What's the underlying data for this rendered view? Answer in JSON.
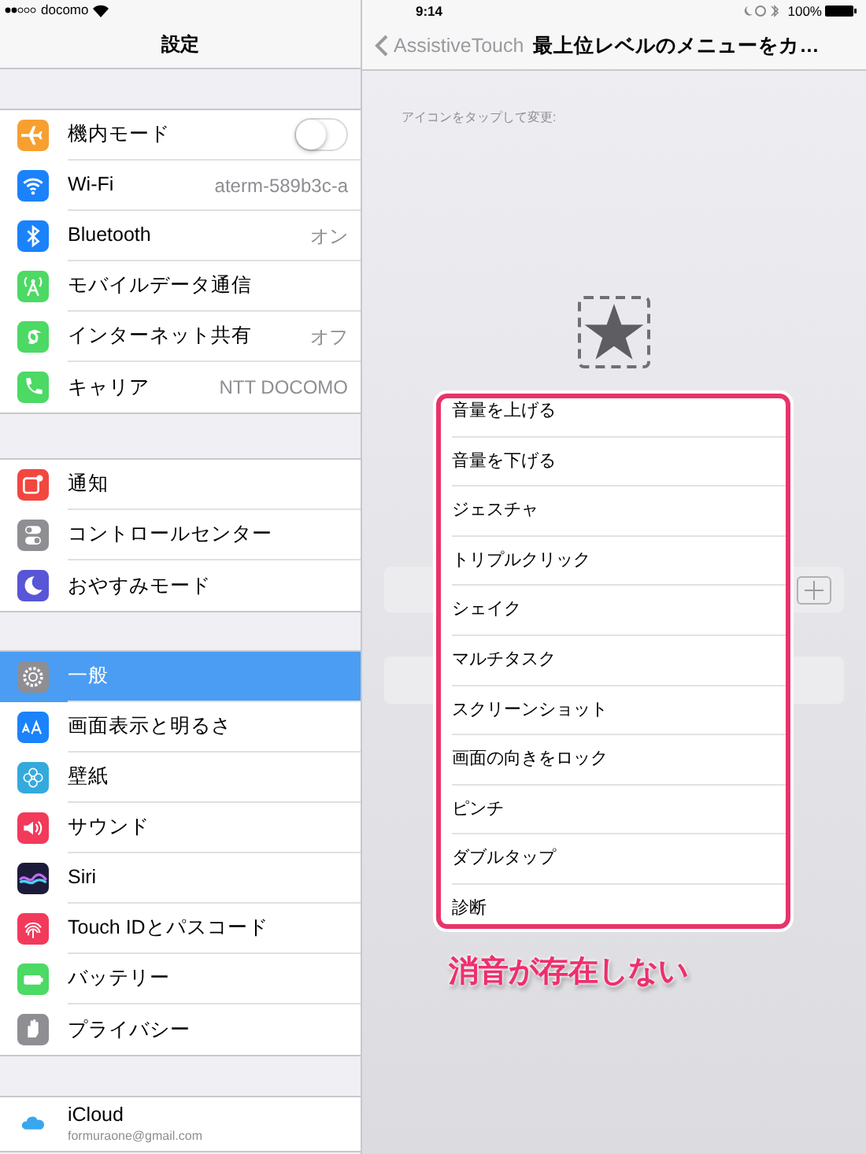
{
  "status_bar": {
    "carrier": "docomo",
    "time": "9:14",
    "battery": "100%"
  },
  "sidebar": {
    "title": "設定",
    "groups": [
      [
        {
          "kind": "toggle",
          "label": "機内モード",
          "on": false,
          "selected": false
        },
        {
          "kind": "value",
          "label": "Wi-Fi",
          "value": "aterm-589b3c-a",
          "selected": false
        },
        {
          "kind": "value",
          "label": "Bluetooth",
          "value": "オン",
          "selected": false
        },
        {
          "kind": "plain",
          "label": "モバイルデータ通信",
          "selected": false
        },
        {
          "kind": "value",
          "label": "インターネット共有",
          "value": "オフ",
          "selected": false
        },
        {
          "kind": "value",
          "label": "キャリア",
          "value": "NTT DOCOMO",
          "selected": false
        }
      ],
      [
        {
          "kind": "plain",
          "label": "通知",
          "selected": false
        },
        {
          "kind": "plain",
          "label": "コントロールセンター",
          "selected": false
        },
        {
          "kind": "plain",
          "label": "おやすみモード",
          "selected": false
        }
      ],
      [
        {
          "kind": "plain",
          "label": "一般",
          "selected": true
        },
        {
          "kind": "plain",
          "label": "画面表示と明るさ",
          "selected": false
        },
        {
          "kind": "plain",
          "label": "壁紙",
          "selected": false
        },
        {
          "kind": "plain",
          "label": "サウンド",
          "selected": false
        },
        {
          "kind": "plain",
          "label": "Siri",
          "selected": false
        },
        {
          "kind": "plain",
          "label": "Touch IDとパスコード",
          "selected": false
        },
        {
          "kind": "plain",
          "label": "バッテリー",
          "selected": false
        },
        {
          "kind": "plain",
          "label": "プライバシー",
          "selected": false
        }
      ],
      [
        {
          "kind": "account",
          "label": "iCloud",
          "subtitle": "formuraone@gmail.com",
          "selected": false
        }
      ]
    ]
  },
  "detail": {
    "back_label": "AssistiveTouch",
    "title": "最上位レベルのメニューをカ…",
    "hint": "アイコンをタップして変更:",
    "popover": {
      "items": [
        "音量を上げる",
        "音量を下げる",
        "ジェスチャ",
        "トリプルクリック",
        "シェイク",
        "マルチタスク",
        "スクリーンショット",
        "画面の向きをロック",
        "ピンチ",
        "ダブルタップ",
        "診断"
      ]
    }
  },
  "annotation": {
    "text": "消音が存在しない"
  }
}
